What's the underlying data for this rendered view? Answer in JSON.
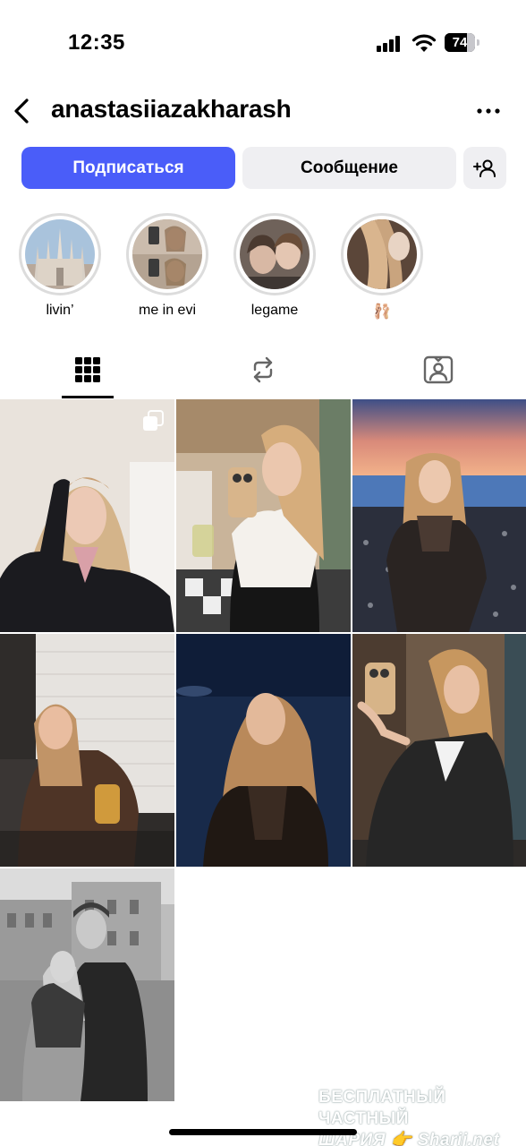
{
  "status_bar": {
    "time": "12:35",
    "battery": "74",
    "battery_level": 0.74
  },
  "header": {
    "username": "anastasiiazakharash"
  },
  "actions": {
    "follow_label": "Подписаться",
    "message_label": "Сообщение"
  },
  "highlights": [
    {
      "label": "livin’"
    },
    {
      "label": "me in evi"
    },
    {
      "label": "legame"
    },
    {
      "label": "🩰"
    }
  ],
  "tabs": [
    "posts-grid",
    "reposts",
    "tagged"
  ],
  "posts": [
    {
      "subject": "selfie-indoor",
      "multiple": true
    },
    {
      "subject": "mirror-selfie-white-top",
      "multiple": false
    },
    {
      "subject": "beach-sunset",
      "multiple": false
    },
    {
      "subject": "sitting-with-cup",
      "multiple": false
    },
    {
      "subject": "night-sea",
      "multiple": false
    },
    {
      "subject": "mirror-selfie-leather-jacket",
      "multiple": false
    },
    {
      "subject": "couple-street-bw",
      "multiple": false
    }
  ],
  "watermark": {
    "line1": "БЕСПЛАТНЫЙ ЧАСТНЫЙ",
    "line2": "ШАРИЯ 👉 Sharij.net"
  },
  "colors": {
    "accent": "#4a5df9",
    "button_bg": "#efeff2",
    "ring": "#dcdcdc"
  }
}
